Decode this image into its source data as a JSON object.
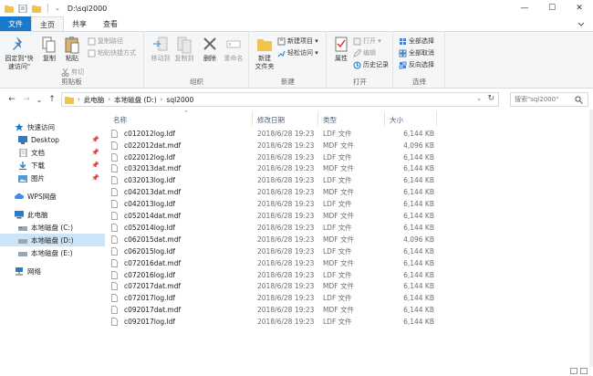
{
  "window": {
    "title": "D:\\sql2000",
    "minimize": "—",
    "maximize": "☐",
    "close": "✕"
  },
  "ribbon_tabs": {
    "file": "文件",
    "home": "主页",
    "share": "共享",
    "view": "查看"
  },
  "ribbon": {
    "clipboard": {
      "label": "剪贴板",
      "pin": "固定到\"快\n速访问\"",
      "copy": "复制",
      "paste": "粘贴",
      "copy_path": "复制路径",
      "paste_shortcut": "粘贴快捷方式",
      "cut": "剪切"
    },
    "organize": {
      "label": "组织",
      "move_to": "移动到",
      "copy_to": "复制到",
      "delete": "删除",
      "rename": "重命名"
    },
    "new": {
      "label": "新建",
      "new_folder": "新建\n文件夹",
      "new_item": "新建项目 ▾",
      "easy_access": "轻松访问 ▾"
    },
    "open": {
      "label": "打开",
      "properties": "属性",
      "open": "打开 ▾",
      "edit": "编辑",
      "history": "历史记录"
    },
    "select": {
      "label": "选择",
      "select_all": "全部选择",
      "select_none": "全部取消",
      "invert": "反向选择"
    }
  },
  "address": {
    "back": "←",
    "forward": "→",
    "recent": "⌄",
    "up": "↑",
    "crumbs": [
      "此电脑",
      "本地磁盘 (D:)",
      "sql2000"
    ],
    "search_placeholder": "搜索\"sql2000\""
  },
  "nav": {
    "quick_access": "快速访问",
    "desktop": "Desktop",
    "documents": "文档",
    "downloads": "下载",
    "pictures": "图片",
    "wps": "WPS网盘",
    "this_pc": "此电脑",
    "drive_c": "本地磁盘 (C:)",
    "drive_d": "本地磁盘 (D:)",
    "drive_e": "本地磁盘 (E:)",
    "network": "网络"
  },
  "columns": {
    "name": "名称",
    "date": "修改日期",
    "type": "类型",
    "size": "大小"
  },
  "files": [
    {
      "name": "c012012log.ldf",
      "date": "2018/6/28 19:23",
      "type": "LDF 文件",
      "size": "6,144 KB"
    },
    {
      "name": "c022012dat.mdf",
      "date": "2018/6/28 19:23",
      "type": "MDF 文件",
      "size": "4,096 KB"
    },
    {
      "name": "c022012log.ldf",
      "date": "2018/6/28 19:23",
      "type": "LDF 文件",
      "size": "6,144 KB"
    },
    {
      "name": "c032013dat.mdf",
      "date": "2018/6/28 19:23",
      "type": "MDF 文件",
      "size": "6,144 KB"
    },
    {
      "name": "c032013log.ldf",
      "date": "2018/6/28 19:23",
      "type": "LDF 文件",
      "size": "6,144 KB"
    },
    {
      "name": "c042013dat.mdf",
      "date": "2018/6/28 19:23",
      "type": "MDF 文件",
      "size": "6,144 KB"
    },
    {
      "name": "c042013log.ldf",
      "date": "2018/6/28 19:23",
      "type": "LDF 文件",
      "size": "6,144 KB"
    },
    {
      "name": "c052014dat.mdf",
      "date": "2018/6/28 19:23",
      "type": "MDF 文件",
      "size": "6,144 KB"
    },
    {
      "name": "c052014log.ldf",
      "date": "2018/6/28 19:23",
      "type": "LDF 文件",
      "size": "6,144 KB"
    },
    {
      "name": "c062015dat.mdf",
      "date": "2018/6/28 19:23",
      "type": "MDF 文件",
      "size": "4,096 KB"
    },
    {
      "name": "c062015log.ldf",
      "date": "2018/6/28 19:23",
      "type": "LDF 文件",
      "size": "6,144 KB"
    },
    {
      "name": "c072016dat.mdf",
      "date": "2018/6/28 19:23",
      "type": "MDF 文件",
      "size": "6,144 KB"
    },
    {
      "name": "c072016log.ldf",
      "date": "2018/6/28 19:23",
      "type": "LDF 文件",
      "size": "6,144 KB"
    },
    {
      "name": "c072017dat.mdf",
      "date": "2018/6/28 19:23",
      "type": "MDF 文件",
      "size": "6,144 KB"
    },
    {
      "name": "c072017log.ldf",
      "date": "2018/6/28 19:23",
      "type": "LDF 文件",
      "size": "6,144 KB"
    },
    {
      "name": "c092017dat.mdf",
      "date": "2018/6/28 19:23",
      "type": "MDF 文件",
      "size": "6,144 KB"
    },
    {
      "name": "c092017log.ldf",
      "date": "2018/6/28 19:23",
      "type": "LDF 文件",
      "size": "6,144 KB"
    }
  ],
  "colors": {
    "accent": "#1979ca",
    "selected": "#cce4f7",
    "folder": "#f2c34c"
  }
}
